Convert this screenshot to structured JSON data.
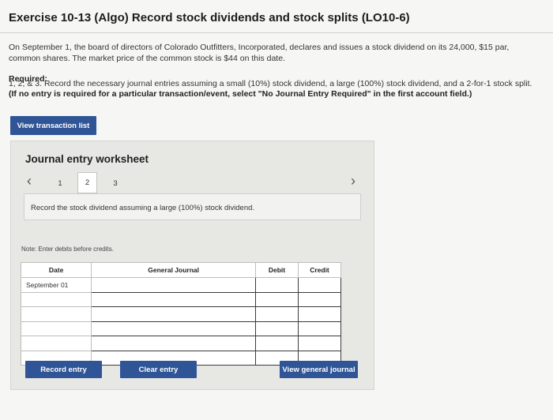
{
  "header": {
    "title": "Exercise 10-13 (Algo) Record stock dividends and stock splits (LO10-6)"
  },
  "problem": {
    "text": "On September 1, the board of directors of Colorado Outfitters, Incorporated, declares and issues a stock dividend on its 24,000, $15 par, common shares. The market price of the common stock is $44 on this date."
  },
  "required": {
    "heading": "Required:",
    "text": "1, 2, & 3. Record the necessary journal entries assuming a small (10%) stock dividend, a large (100%) stock dividend, and a 2-for-1 stock split.",
    "bold_instruction": "(If no entry is required for a particular transaction/event, select \"No Journal Entry Required\" in the first account field.)"
  },
  "buttons": {
    "view_transaction_list": "View transaction list",
    "record_entry": "Record entry",
    "clear_entry": "Clear entry",
    "view_general_journal": "View general journal"
  },
  "worksheet": {
    "title": "Journal entry worksheet",
    "pages": [
      "1",
      "2",
      "3"
    ],
    "active_page": "2",
    "instruction": "Record the stock dividend assuming a large (100%) stock dividend.",
    "note": "Note: Enter debits before credits."
  },
  "journal": {
    "headers": {
      "date": "Date",
      "general_journal": "General Journal",
      "debit": "Debit",
      "credit": "Credit"
    },
    "rows": [
      {
        "date": "September 01"
      },
      {
        "date": ""
      },
      {
        "date": ""
      },
      {
        "date": ""
      },
      {
        "date": ""
      },
      {
        "date": ""
      }
    ]
  },
  "icons": {
    "prev": "chevron-left-icon",
    "next": "chevron-right-icon"
  },
  "colors": {
    "button_bg": "#2f5597",
    "panel_bg": "#e7e7e4"
  }
}
